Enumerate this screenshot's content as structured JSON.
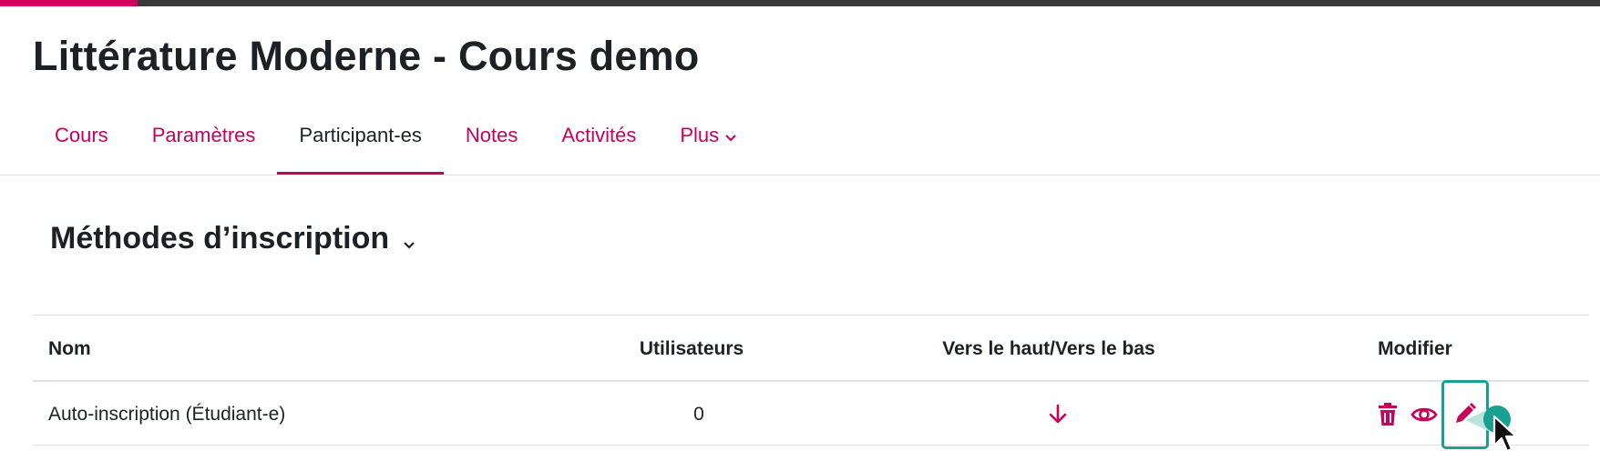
{
  "top_bar": {
    "progress_fraction": 0.086
  },
  "course": {
    "title": "Littérature Moderne - Cours demo"
  },
  "tabs": [
    {
      "label": "Cours",
      "active": false
    },
    {
      "label": "Paramètres",
      "active": false
    },
    {
      "label": "Participant-es",
      "active": true
    },
    {
      "label": "Notes",
      "active": false
    },
    {
      "label": "Activités",
      "active": false
    },
    {
      "label": "Plus",
      "active": false,
      "icon": "chevron-down-icon"
    }
  ],
  "section": {
    "title": "Méthodes d’inscription",
    "icon": "chevron-down-icon"
  },
  "table": {
    "headers": {
      "name": "Nom",
      "users": "Utilisateurs",
      "order": "Vers le haut/Vers le bas",
      "edit": "Modifier"
    },
    "rows": [
      {
        "name": "Auto-inscription (Étudiant-e)",
        "users": "0",
        "order_icon": "arrow-down-icon",
        "actions": [
          "trash-icon",
          "eye-icon",
          "pencil-icon"
        ]
      }
    ]
  },
  "colors": {
    "accent": "#c7005a",
    "text": "#1d2125",
    "focus": "#1aa091",
    "border": "#dee2e6"
  }
}
